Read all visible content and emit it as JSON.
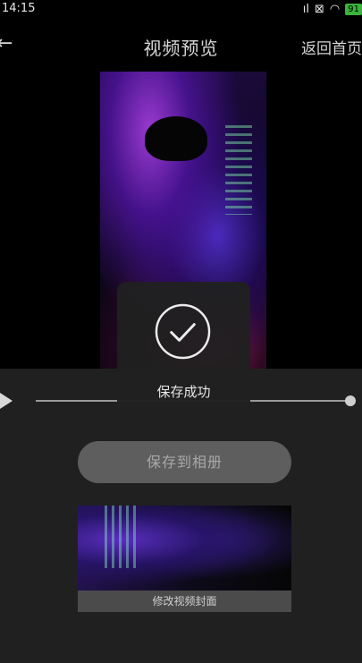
{
  "status_bar": {
    "time": "14:15",
    "battery": "91"
  },
  "nav": {
    "title": "视频预览",
    "home_label": "返回首页"
  },
  "player": {
    "progress": 1.0
  },
  "toast": {
    "message": "保存成功"
  },
  "actions": {
    "save_label": "保存到相册"
  },
  "cover": {
    "label": "修改视频封面"
  }
}
